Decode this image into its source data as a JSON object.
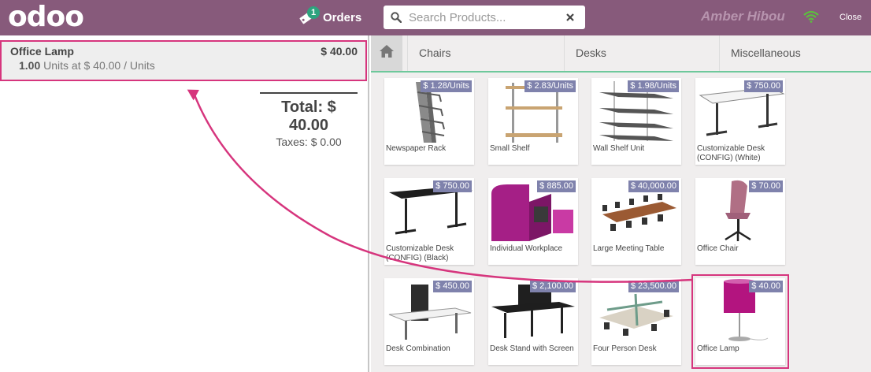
{
  "header": {
    "logo": "odoo",
    "orders_label": "Orders",
    "orders_count": "1",
    "search_placeholder": "Search Products...",
    "cashier": "Amber Hibou",
    "close_label": "Close"
  },
  "order": {
    "line": {
      "name": "Office Lamp",
      "price": "$ 40.00",
      "qty": "1.00",
      "detail": "Units at $ 40.00 / Units"
    },
    "total": "Total: $ 40.00",
    "taxes": "Taxes: $ 0.00"
  },
  "categories": [
    "Chairs",
    "Desks",
    "Miscellaneous"
  ],
  "products": [
    {
      "name": "Newspaper Rack",
      "price": "$ 1.28/Units",
      "icon": "newspaper-rack"
    },
    {
      "name": "Small Shelf",
      "price": "$ 2.83/Units",
      "icon": "small-shelf"
    },
    {
      "name": "Wall Shelf Unit",
      "price": "$ 1.98/Units",
      "icon": "wall-shelf"
    },
    {
      "name": "Customizable Desk (CONFIG) (White)",
      "price": "$ 750.00",
      "icon": "desk-white"
    },
    {
      "name": "Customizable Desk (CONFIG) (Black)",
      "price": "$ 750.00",
      "icon": "desk-black"
    },
    {
      "name": "Individual Workplace",
      "price": "$ 885.00",
      "icon": "individual-workplace"
    },
    {
      "name": "Large Meeting Table",
      "price": "$ 40,000.00",
      "icon": "meeting-table"
    },
    {
      "name": "Office Chair",
      "price": "$ 70.00",
      "icon": "office-chair"
    },
    {
      "name": "Desk Combination",
      "price": "$ 450.00",
      "icon": "desk-combination"
    },
    {
      "name": "Desk Stand with Screen",
      "price": "$ 2,100.00",
      "icon": "desk-stand-screen"
    },
    {
      "name": "Four Person Desk",
      "price": "$ 23,500.00",
      "icon": "four-person-desk"
    },
    {
      "name": "Office Lamp",
      "price": "$ 40.00",
      "icon": "office-lamp"
    }
  ],
  "colors": {
    "brand": "#875A7B",
    "highlight": "#d6357d",
    "accent": "#6ec89b",
    "price_tag": "#7f82ac"
  }
}
